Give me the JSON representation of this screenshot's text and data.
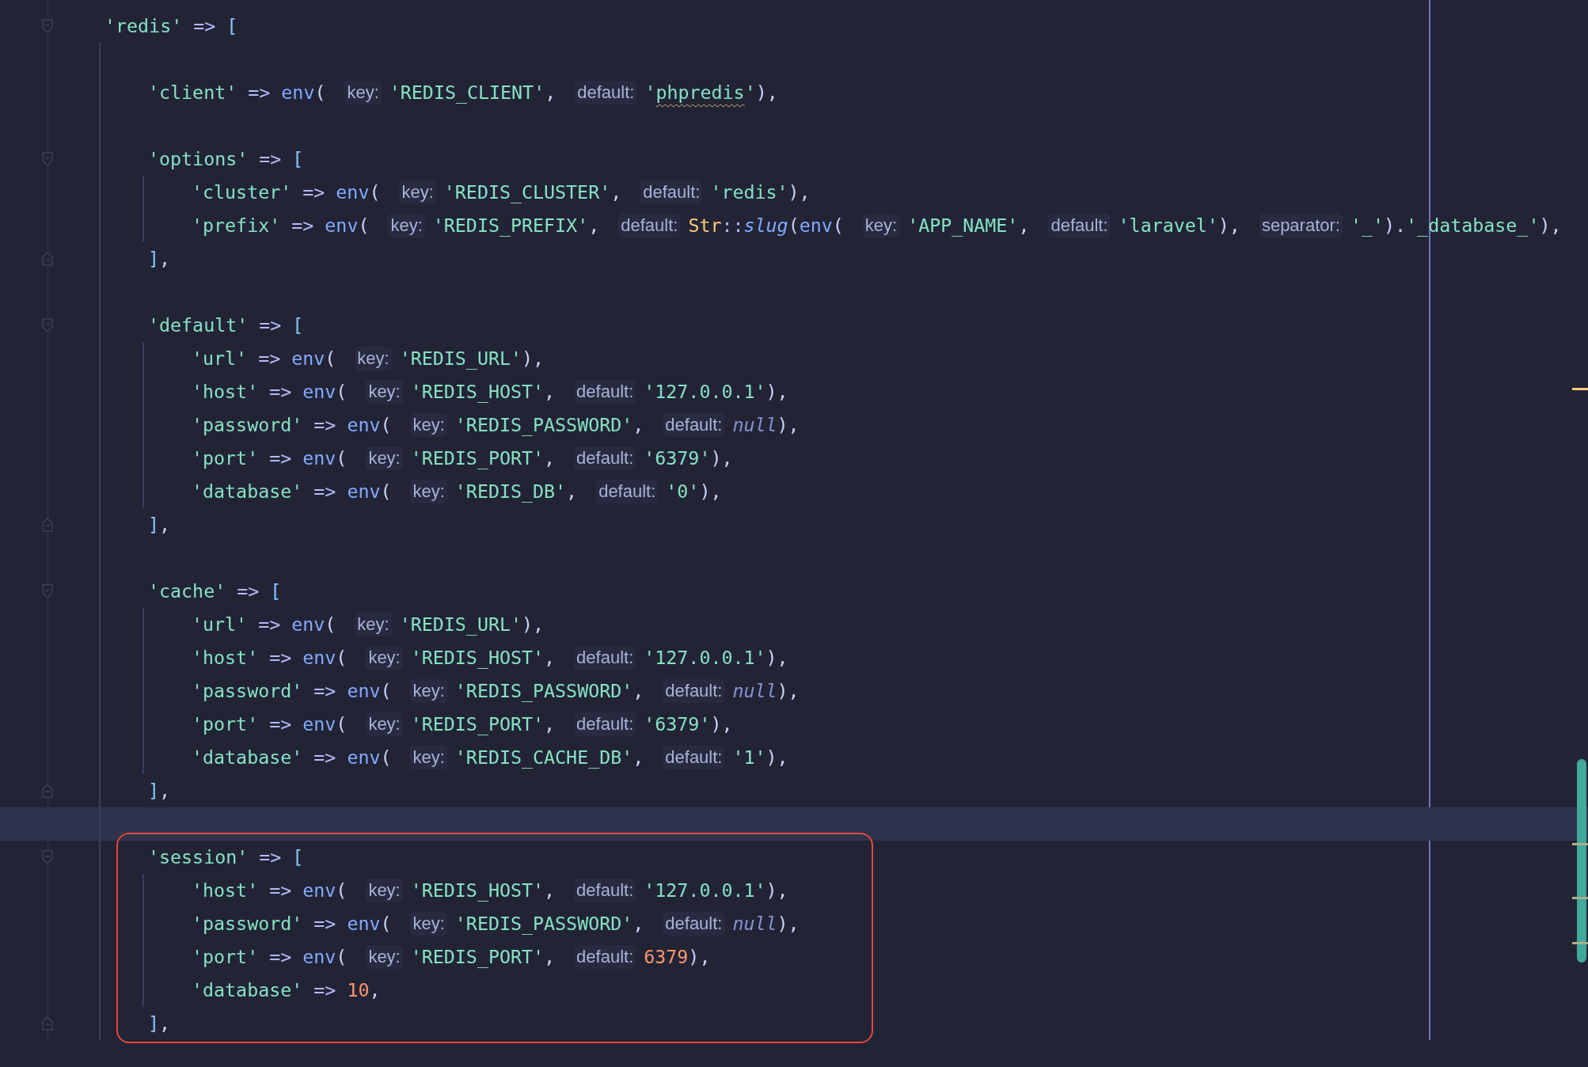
{
  "lines": [
    {
      "current": false,
      "boxed": false,
      "tokens": [
        {
          "kind": "str",
          "text": "'redis'"
        },
        {
          "kind": "op",
          "text": " => "
        },
        {
          "kind": "bracket",
          "text": "["
        }
      ],
      "children": [
        {
          "current": false,
          "boxed": false
        },
        {
          "current": false,
          "boxed": false,
          "tokens": [
            {
              "kind": "str",
              "text": "'client'"
            },
            {
              "kind": "op",
              "text": " => "
            },
            {
              "kind": "fn",
              "text": "env"
            },
            {
              "kind": "punct",
              "text": "("
            },
            {
              "kind": "hint",
              "text": "key:"
            },
            {
              "kind": "str",
              "text": "'REDIS_CLIENT'"
            },
            {
              "kind": "punct",
              "text": ","
            },
            {
              "kind": "hint",
              "text": "default:"
            },
            {
              "kind": "str",
              "text": "'"
            },
            {
              "kind": "typo",
              "text": "phpredis"
            },
            {
              "kind": "str",
              "text": "'"
            },
            {
              "kind": "punct",
              "text": "),"
            }
          ]
        },
        {
          "current": false,
          "boxed": false
        },
        {
          "current": false,
          "boxed": false,
          "tokens": [
            {
              "kind": "str",
              "text": "'options'"
            },
            {
              "kind": "op",
              "text": " => "
            },
            {
              "kind": "bracket",
              "text": "["
            }
          ],
          "close": [
            {
              "kind": "bracket",
              "text": "]"
            },
            {
              "kind": "punct",
              "text": ","
            }
          ],
          "children": [
            {
              "current": false,
              "boxed": false,
              "tokens": [
                {
                  "kind": "str",
                  "text": "'cluster'"
                },
                {
                  "kind": "op",
                  "text": " => "
                },
                {
                  "kind": "fn",
                  "text": "env"
                },
                {
                  "kind": "punct",
                  "text": "("
                },
                {
                  "kind": "hint",
                  "text": "key:"
                },
                {
                  "kind": "str",
                  "text": "'REDIS_CLUSTER'"
                },
                {
                  "kind": "punct",
                  "text": ","
                },
                {
                  "kind": "hint",
                  "text": "default:"
                },
                {
                  "kind": "str",
                  "text": "'redis'"
                },
                {
                  "kind": "punct",
                  "text": "),"
                }
              ]
            },
            {
              "current": false,
              "boxed": false,
              "tokens": [
                {
                  "kind": "str",
                  "text": "'prefix'"
                },
                {
                  "kind": "op",
                  "text": " => "
                },
                {
                  "kind": "fn",
                  "text": "env"
                },
                {
                  "kind": "punct",
                  "text": "("
                },
                {
                  "kind": "hint",
                  "text": "key:"
                },
                {
                  "kind": "str",
                  "text": "'REDIS_PREFIX'"
                },
                {
                  "kind": "punct",
                  "text": ","
                },
                {
                  "kind": "hint",
                  "text": "default:"
                },
                {
                  "kind": "cls",
                  "text": "Str"
                },
                {
                  "kind": "op",
                  "text": "::"
                },
                {
                  "kind": "method",
                  "text": "slug"
                },
                {
                  "kind": "punct",
                  "text": "("
                },
                {
                  "kind": "fn",
                  "text": "env"
                },
                {
                  "kind": "punct",
                  "text": "("
                },
                {
                  "kind": "hint",
                  "text": "key:"
                },
                {
                  "kind": "str",
                  "text": "'APP_NAME'"
                },
                {
                  "kind": "punct",
                  "text": ","
                },
                {
                  "kind": "hint",
                  "text": "default:"
                },
                {
                  "kind": "str",
                  "text": "'laravel'"
                },
                {
                  "kind": "punct",
                  "text": "),"
                },
                {
                  "kind": "hint",
                  "text": "separator:"
                },
                {
                  "kind": "str",
                  "text": "'_'"
                },
                {
                  "kind": "punct",
                  "text": ")."
                },
                {
                  "kind": "str",
                  "text": "'_database_'"
                },
                {
                  "kind": "punct",
                  "text": "),"
                }
              ]
            }
          ]
        },
        {
          "current": false,
          "boxed": false
        },
        {
          "current": false,
          "boxed": false,
          "tokens": [
            {
              "kind": "str",
              "text": "'default'"
            },
            {
              "kind": "op",
              "text": " => "
            },
            {
              "kind": "bracket",
              "text": "["
            }
          ],
          "close": [
            {
              "kind": "bracket",
              "text": "]"
            },
            {
              "kind": "punct",
              "text": ","
            }
          ],
          "children": [
            {
              "current": false,
              "boxed": false,
              "tokens": [
                {
                  "kind": "str",
                  "text": "'url'"
                },
                {
                  "kind": "op",
                  "text": " => "
                },
                {
                  "kind": "fn",
                  "text": "env"
                },
                {
                  "kind": "punct",
                  "text": "("
                },
                {
                  "kind": "hint",
                  "text": "key:"
                },
                {
                  "kind": "str",
                  "text": "'REDIS_URL'"
                },
                {
                  "kind": "punct",
                  "text": "),"
                }
              ]
            },
            {
              "current": false,
              "boxed": false,
              "tokens": [
                {
                  "kind": "str",
                  "text": "'host'"
                },
                {
                  "kind": "op",
                  "text": " => "
                },
                {
                  "kind": "fn",
                  "text": "env"
                },
                {
                  "kind": "punct",
                  "text": "("
                },
                {
                  "kind": "hint",
                  "text": "key:"
                },
                {
                  "kind": "str",
                  "text": "'REDIS_HOST'"
                },
                {
                  "kind": "punct",
                  "text": ","
                },
                {
                  "kind": "hint",
                  "text": "default:"
                },
                {
                  "kind": "str",
                  "text": "'127.0.0.1'"
                },
                {
                  "kind": "punct",
                  "text": "),"
                }
              ]
            },
            {
              "current": false,
              "boxed": false,
              "tokens": [
                {
                  "kind": "str",
                  "text": "'password'"
                },
                {
                  "kind": "op",
                  "text": " => "
                },
                {
                  "kind": "fn",
                  "text": "env"
                },
                {
                  "kind": "punct",
                  "text": "("
                },
                {
                  "kind": "hint",
                  "text": "key:"
                },
                {
                  "kind": "str",
                  "text": "'REDIS_PASSWORD'"
                },
                {
                  "kind": "punct",
                  "text": ","
                },
                {
                  "kind": "hint",
                  "text": "default:"
                },
                {
                  "kind": "null",
                  "text": "null"
                },
                {
                  "kind": "punct",
                  "text": "),"
                }
              ]
            },
            {
              "current": false,
              "boxed": false,
              "tokens": [
                {
                  "kind": "str",
                  "text": "'port'"
                },
                {
                  "kind": "op",
                  "text": " => "
                },
                {
                  "kind": "fn",
                  "text": "env"
                },
                {
                  "kind": "punct",
                  "text": "("
                },
                {
                  "kind": "hint",
                  "text": "key:"
                },
                {
                  "kind": "str",
                  "text": "'REDIS_PORT'"
                },
                {
                  "kind": "punct",
                  "text": ","
                },
                {
                  "kind": "hint",
                  "text": "default:"
                },
                {
                  "kind": "str",
                  "text": "'6379'"
                },
                {
                  "kind": "punct",
                  "text": "),"
                }
              ]
            },
            {
              "current": false,
              "boxed": false,
              "tokens": [
                {
                  "kind": "str",
                  "text": "'database'"
                },
                {
                  "kind": "op",
                  "text": " => "
                },
                {
                  "kind": "fn",
                  "text": "env"
                },
                {
                  "kind": "punct",
                  "text": "("
                },
                {
                  "kind": "hint",
                  "text": "key:"
                },
                {
                  "kind": "str",
                  "text": "'REDIS_DB'"
                },
                {
                  "kind": "punct",
                  "text": ","
                },
                {
                  "kind": "hint",
                  "text": "default:"
                },
                {
                  "kind": "str",
                  "text": "'0'"
                },
                {
                  "kind": "punct",
                  "text": "),"
                }
              ]
            }
          ]
        },
        {
          "current": false,
          "boxed": false
        },
        {
          "current": false,
          "boxed": false,
          "tokens": [
            {
              "kind": "str",
              "text": "'cache'"
            },
            {
              "kind": "op",
              "text": " => "
            },
            {
              "kind": "bracket",
              "text": "["
            }
          ],
          "close": [
            {
              "kind": "bracket",
              "text": "]"
            },
            {
              "kind": "punct",
              "text": ","
            }
          ],
          "children": [
            {
              "current": false,
              "boxed": false,
              "tokens": [
                {
                  "kind": "str",
                  "text": "'url'"
                },
                {
                  "kind": "op",
                  "text": " => "
                },
                {
                  "kind": "fn",
                  "text": "env"
                },
                {
                  "kind": "punct",
                  "text": "("
                },
                {
                  "kind": "hint",
                  "text": "key:"
                },
                {
                  "kind": "str",
                  "text": "'REDIS_URL'"
                },
                {
                  "kind": "punct",
                  "text": "),"
                }
              ]
            },
            {
              "current": false,
              "boxed": false,
              "tokens": [
                {
                  "kind": "str",
                  "text": "'host'"
                },
                {
                  "kind": "op",
                  "text": " => "
                },
                {
                  "kind": "fn",
                  "text": "env"
                },
                {
                  "kind": "punct",
                  "text": "("
                },
                {
                  "kind": "hint",
                  "text": "key:"
                },
                {
                  "kind": "str",
                  "text": "'REDIS_HOST'"
                },
                {
                  "kind": "punct",
                  "text": ","
                },
                {
                  "kind": "hint",
                  "text": "default:"
                },
                {
                  "kind": "str",
                  "text": "'127.0.0.1'"
                },
                {
                  "kind": "punct",
                  "text": "),"
                }
              ]
            },
            {
              "current": false,
              "boxed": false,
              "tokens": [
                {
                  "kind": "str",
                  "text": "'password'"
                },
                {
                  "kind": "op",
                  "text": " => "
                },
                {
                  "kind": "fn",
                  "text": "env"
                },
                {
                  "kind": "punct",
                  "text": "("
                },
                {
                  "kind": "hint",
                  "text": "key:"
                },
                {
                  "kind": "str",
                  "text": "'REDIS_PASSWORD'"
                },
                {
                  "kind": "punct",
                  "text": ","
                },
                {
                  "kind": "hint",
                  "text": "default:"
                },
                {
                  "kind": "null",
                  "text": "null"
                },
                {
                  "kind": "punct",
                  "text": "),"
                }
              ]
            },
            {
              "current": false,
              "boxed": false,
              "tokens": [
                {
                  "kind": "str",
                  "text": "'port'"
                },
                {
                  "kind": "op",
                  "text": " => "
                },
                {
                  "kind": "fn",
                  "text": "env"
                },
                {
                  "kind": "punct",
                  "text": "("
                },
                {
                  "kind": "hint",
                  "text": "key:"
                },
                {
                  "kind": "str",
                  "text": "'REDIS_PORT'"
                },
                {
                  "kind": "punct",
                  "text": ","
                },
                {
                  "kind": "hint",
                  "text": "default:"
                },
                {
                  "kind": "str",
                  "text": "'6379'"
                },
                {
                  "kind": "punct",
                  "text": "),"
                }
              ]
            },
            {
              "current": false,
              "boxed": false,
              "tokens": [
                {
                  "kind": "str",
                  "text": "'database'"
                },
                {
                  "kind": "op",
                  "text": " => "
                },
                {
                  "kind": "fn",
                  "text": "env"
                },
                {
                  "kind": "punct",
                  "text": "("
                },
                {
                  "kind": "hint",
                  "text": "key:"
                },
                {
                  "kind": "str",
                  "text": "'REDIS_CACHE_DB'"
                },
                {
                  "kind": "punct",
                  "text": ","
                },
                {
                  "kind": "hint",
                  "text": "default:"
                },
                {
                  "kind": "str",
                  "text": "'1'"
                },
                {
                  "kind": "punct",
                  "text": "),"
                }
              ]
            }
          ]
        },
        {
          "current": true,
          "boxed": false
        },
        {
          "current": false,
          "boxed": true,
          "tokens": [
            {
              "kind": "str",
              "text": "'session'"
            },
            {
              "kind": "op",
              "text": " => "
            },
            {
              "kind": "bracket",
              "text": "["
            }
          ],
          "close": [
            {
              "kind": "bracket",
              "text": "]"
            },
            {
              "kind": "punct",
              "text": ","
            }
          ],
          "children": [
            {
              "current": false,
              "boxed": false,
              "tokens": [
                {
                  "kind": "str",
                  "text": "'host'"
                },
                {
                  "kind": "op",
                  "text": " => "
                },
                {
                  "kind": "fn",
                  "text": "env"
                },
                {
                  "kind": "punct",
                  "text": "("
                },
                {
                  "kind": "hint",
                  "text": "key:"
                },
                {
                  "kind": "str",
                  "text": "'REDIS_HOST'"
                },
                {
                  "kind": "punct",
                  "text": ","
                },
                {
                  "kind": "hint",
                  "text": "default:"
                },
                {
                  "kind": "str",
                  "text": "'127.0.0.1'"
                },
                {
                  "kind": "punct",
                  "text": "),"
                }
              ]
            },
            {
              "current": false,
              "boxed": false,
              "tokens": [
                {
                  "kind": "str",
                  "text": "'password'"
                },
                {
                  "kind": "op",
                  "text": " => "
                },
                {
                  "kind": "fn",
                  "text": "env"
                },
                {
                  "kind": "punct",
                  "text": "("
                },
                {
                  "kind": "hint",
                  "text": "key:"
                },
                {
                  "kind": "str",
                  "text": "'REDIS_PASSWORD'"
                },
                {
                  "kind": "punct",
                  "text": ","
                },
                {
                  "kind": "hint",
                  "text": "default:"
                },
                {
                  "kind": "null",
                  "text": "null"
                },
                {
                  "kind": "punct",
                  "text": "),"
                }
              ]
            },
            {
              "current": false,
              "boxed": false,
              "tokens": [
                {
                  "kind": "str",
                  "text": "'port'"
                },
                {
                  "kind": "op",
                  "text": " => "
                },
                {
                  "kind": "fn",
                  "text": "env"
                },
                {
                  "kind": "punct",
                  "text": "("
                },
                {
                  "kind": "hint",
                  "text": "key:"
                },
                {
                  "kind": "str",
                  "text": "'REDIS_PORT'"
                },
                {
                  "kind": "punct",
                  "text": ","
                },
                {
                  "kind": "hint",
                  "text": "default:"
                },
                {
                  "kind": "num",
                  "text": "6379"
                },
                {
                  "kind": "punct",
                  "text": "),"
                }
              ]
            },
            {
              "current": false,
              "boxed": false,
              "tokens": [
                {
                  "kind": "str",
                  "text": "'database'"
                },
                {
                  "kind": "op",
                  "text": " => "
                },
                {
                  "kind": "num",
                  "text": "10"
                },
                {
                  "kind": "punct",
                  "text": ","
                }
              ]
            }
          ]
        }
      ]
    }
  ]
}
